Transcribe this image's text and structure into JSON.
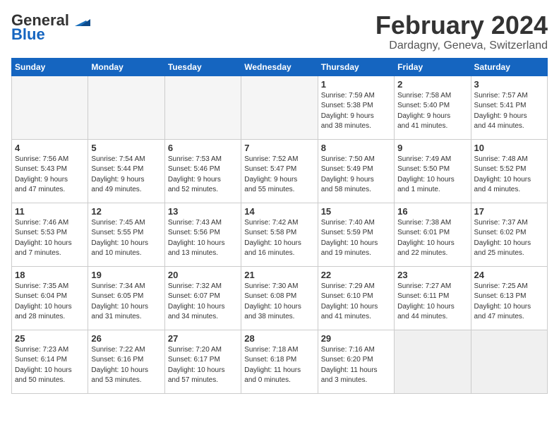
{
  "logo": {
    "text_general": "General",
    "text_blue": "Blue"
  },
  "title": "February 2024",
  "subtitle": "Dardagny, Geneva, Switzerland",
  "days_header": [
    "Sunday",
    "Monday",
    "Tuesday",
    "Wednesday",
    "Thursday",
    "Friday",
    "Saturday"
  ],
  "weeks": [
    [
      {
        "day": "",
        "info": "",
        "empty": true
      },
      {
        "day": "",
        "info": "",
        "empty": true
      },
      {
        "day": "",
        "info": "",
        "empty": true
      },
      {
        "day": "",
        "info": "",
        "empty": true
      },
      {
        "day": "1",
        "info": "Sunrise: 7:59 AM\nSunset: 5:38 PM\nDaylight: 9 hours\nand 38 minutes."
      },
      {
        "day": "2",
        "info": "Sunrise: 7:58 AM\nSunset: 5:40 PM\nDaylight: 9 hours\nand 41 minutes."
      },
      {
        "day": "3",
        "info": "Sunrise: 7:57 AM\nSunset: 5:41 PM\nDaylight: 9 hours\nand 44 minutes."
      }
    ],
    [
      {
        "day": "4",
        "info": "Sunrise: 7:56 AM\nSunset: 5:43 PM\nDaylight: 9 hours\nand 47 minutes."
      },
      {
        "day": "5",
        "info": "Sunrise: 7:54 AM\nSunset: 5:44 PM\nDaylight: 9 hours\nand 49 minutes."
      },
      {
        "day": "6",
        "info": "Sunrise: 7:53 AM\nSunset: 5:46 PM\nDaylight: 9 hours\nand 52 minutes."
      },
      {
        "day": "7",
        "info": "Sunrise: 7:52 AM\nSunset: 5:47 PM\nDaylight: 9 hours\nand 55 minutes."
      },
      {
        "day": "8",
        "info": "Sunrise: 7:50 AM\nSunset: 5:49 PM\nDaylight: 9 hours\nand 58 minutes."
      },
      {
        "day": "9",
        "info": "Sunrise: 7:49 AM\nSunset: 5:50 PM\nDaylight: 10 hours\nand 1 minute."
      },
      {
        "day": "10",
        "info": "Sunrise: 7:48 AM\nSunset: 5:52 PM\nDaylight: 10 hours\nand 4 minutes."
      }
    ],
    [
      {
        "day": "11",
        "info": "Sunrise: 7:46 AM\nSunset: 5:53 PM\nDaylight: 10 hours\nand 7 minutes."
      },
      {
        "day": "12",
        "info": "Sunrise: 7:45 AM\nSunset: 5:55 PM\nDaylight: 10 hours\nand 10 minutes."
      },
      {
        "day": "13",
        "info": "Sunrise: 7:43 AM\nSunset: 5:56 PM\nDaylight: 10 hours\nand 13 minutes."
      },
      {
        "day": "14",
        "info": "Sunrise: 7:42 AM\nSunset: 5:58 PM\nDaylight: 10 hours\nand 16 minutes."
      },
      {
        "day": "15",
        "info": "Sunrise: 7:40 AM\nSunset: 5:59 PM\nDaylight: 10 hours\nand 19 minutes."
      },
      {
        "day": "16",
        "info": "Sunrise: 7:38 AM\nSunset: 6:01 PM\nDaylight: 10 hours\nand 22 minutes."
      },
      {
        "day": "17",
        "info": "Sunrise: 7:37 AM\nSunset: 6:02 PM\nDaylight: 10 hours\nand 25 minutes."
      }
    ],
    [
      {
        "day": "18",
        "info": "Sunrise: 7:35 AM\nSunset: 6:04 PM\nDaylight: 10 hours\nand 28 minutes."
      },
      {
        "day": "19",
        "info": "Sunrise: 7:34 AM\nSunset: 6:05 PM\nDaylight: 10 hours\nand 31 minutes."
      },
      {
        "day": "20",
        "info": "Sunrise: 7:32 AM\nSunset: 6:07 PM\nDaylight: 10 hours\nand 34 minutes."
      },
      {
        "day": "21",
        "info": "Sunrise: 7:30 AM\nSunset: 6:08 PM\nDaylight: 10 hours\nand 38 minutes."
      },
      {
        "day": "22",
        "info": "Sunrise: 7:29 AM\nSunset: 6:10 PM\nDaylight: 10 hours\nand 41 minutes."
      },
      {
        "day": "23",
        "info": "Sunrise: 7:27 AM\nSunset: 6:11 PM\nDaylight: 10 hours\nand 44 minutes."
      },
      {
        "day": "24",
        "info": "Sunrise: 7:25 AM\nSunset: 6:13 PM\nDaylight: 10 hours\nand 47 minutes."
      }
    ],
    [
      {
        "day": "25",
        "info": "Sunrise: 7:23 AM\nSunset: 6:14 PM\nDaylight: 10 hours\nand 50 minutes."
      },
      {
        "day": "26",
        "info": "Sunrise: 7:22 AM\nSunset: 6:16 PM\nDaylight: 10 hours\nand 53 minutes."
      },
      {
        "day": "27",
        "info": "Sunrise: 7:20 AM\nSunset: 6:17 PM\nDaylight: 10 hours\nand 57 minutes."
      },
      {
        "day": "28",
        "info": "Sunrise: 7:18 AM\nSunset: 6:18 PM\nDaylight: 11 hours\nand 0 minutes."
      },
      {
        "day": "29",
        "info": "Sunrise: 7:16 AM\nSunset: 6:20 PM\nDaylight: 11 hours\nand 3 minutes."
      },
      {
        "day": "",
        "info": "",
        "empty": true
      },
      {
        "day": "",
        "info": "",
        "empty": true
      }
    ]
  ]
}
